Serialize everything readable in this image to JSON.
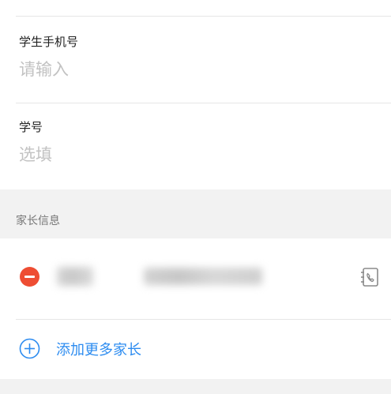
{
  "student_phone": {
    "label": "学生手机号",
    "placeholder": "请输入"
  },
  "student_id": {
    "label": "学号",
    "placeholder": "选填"
  },
  "parent_section": {
    "title": "家长信息",
    "entries": [
      {
        "name": "",
        "phone": ""
      }
    ],
    "add_label": "添加更多家长"
  },
  "colors": {
    "remove": "#ee4d33",
    "accent": "#2d8cf0"
  },
  "icons": {
    "remove": "minus-circle-icon",
    "contacts": "contacts-book-icon",
    "add": "plus-circle-icon"
  }
}
